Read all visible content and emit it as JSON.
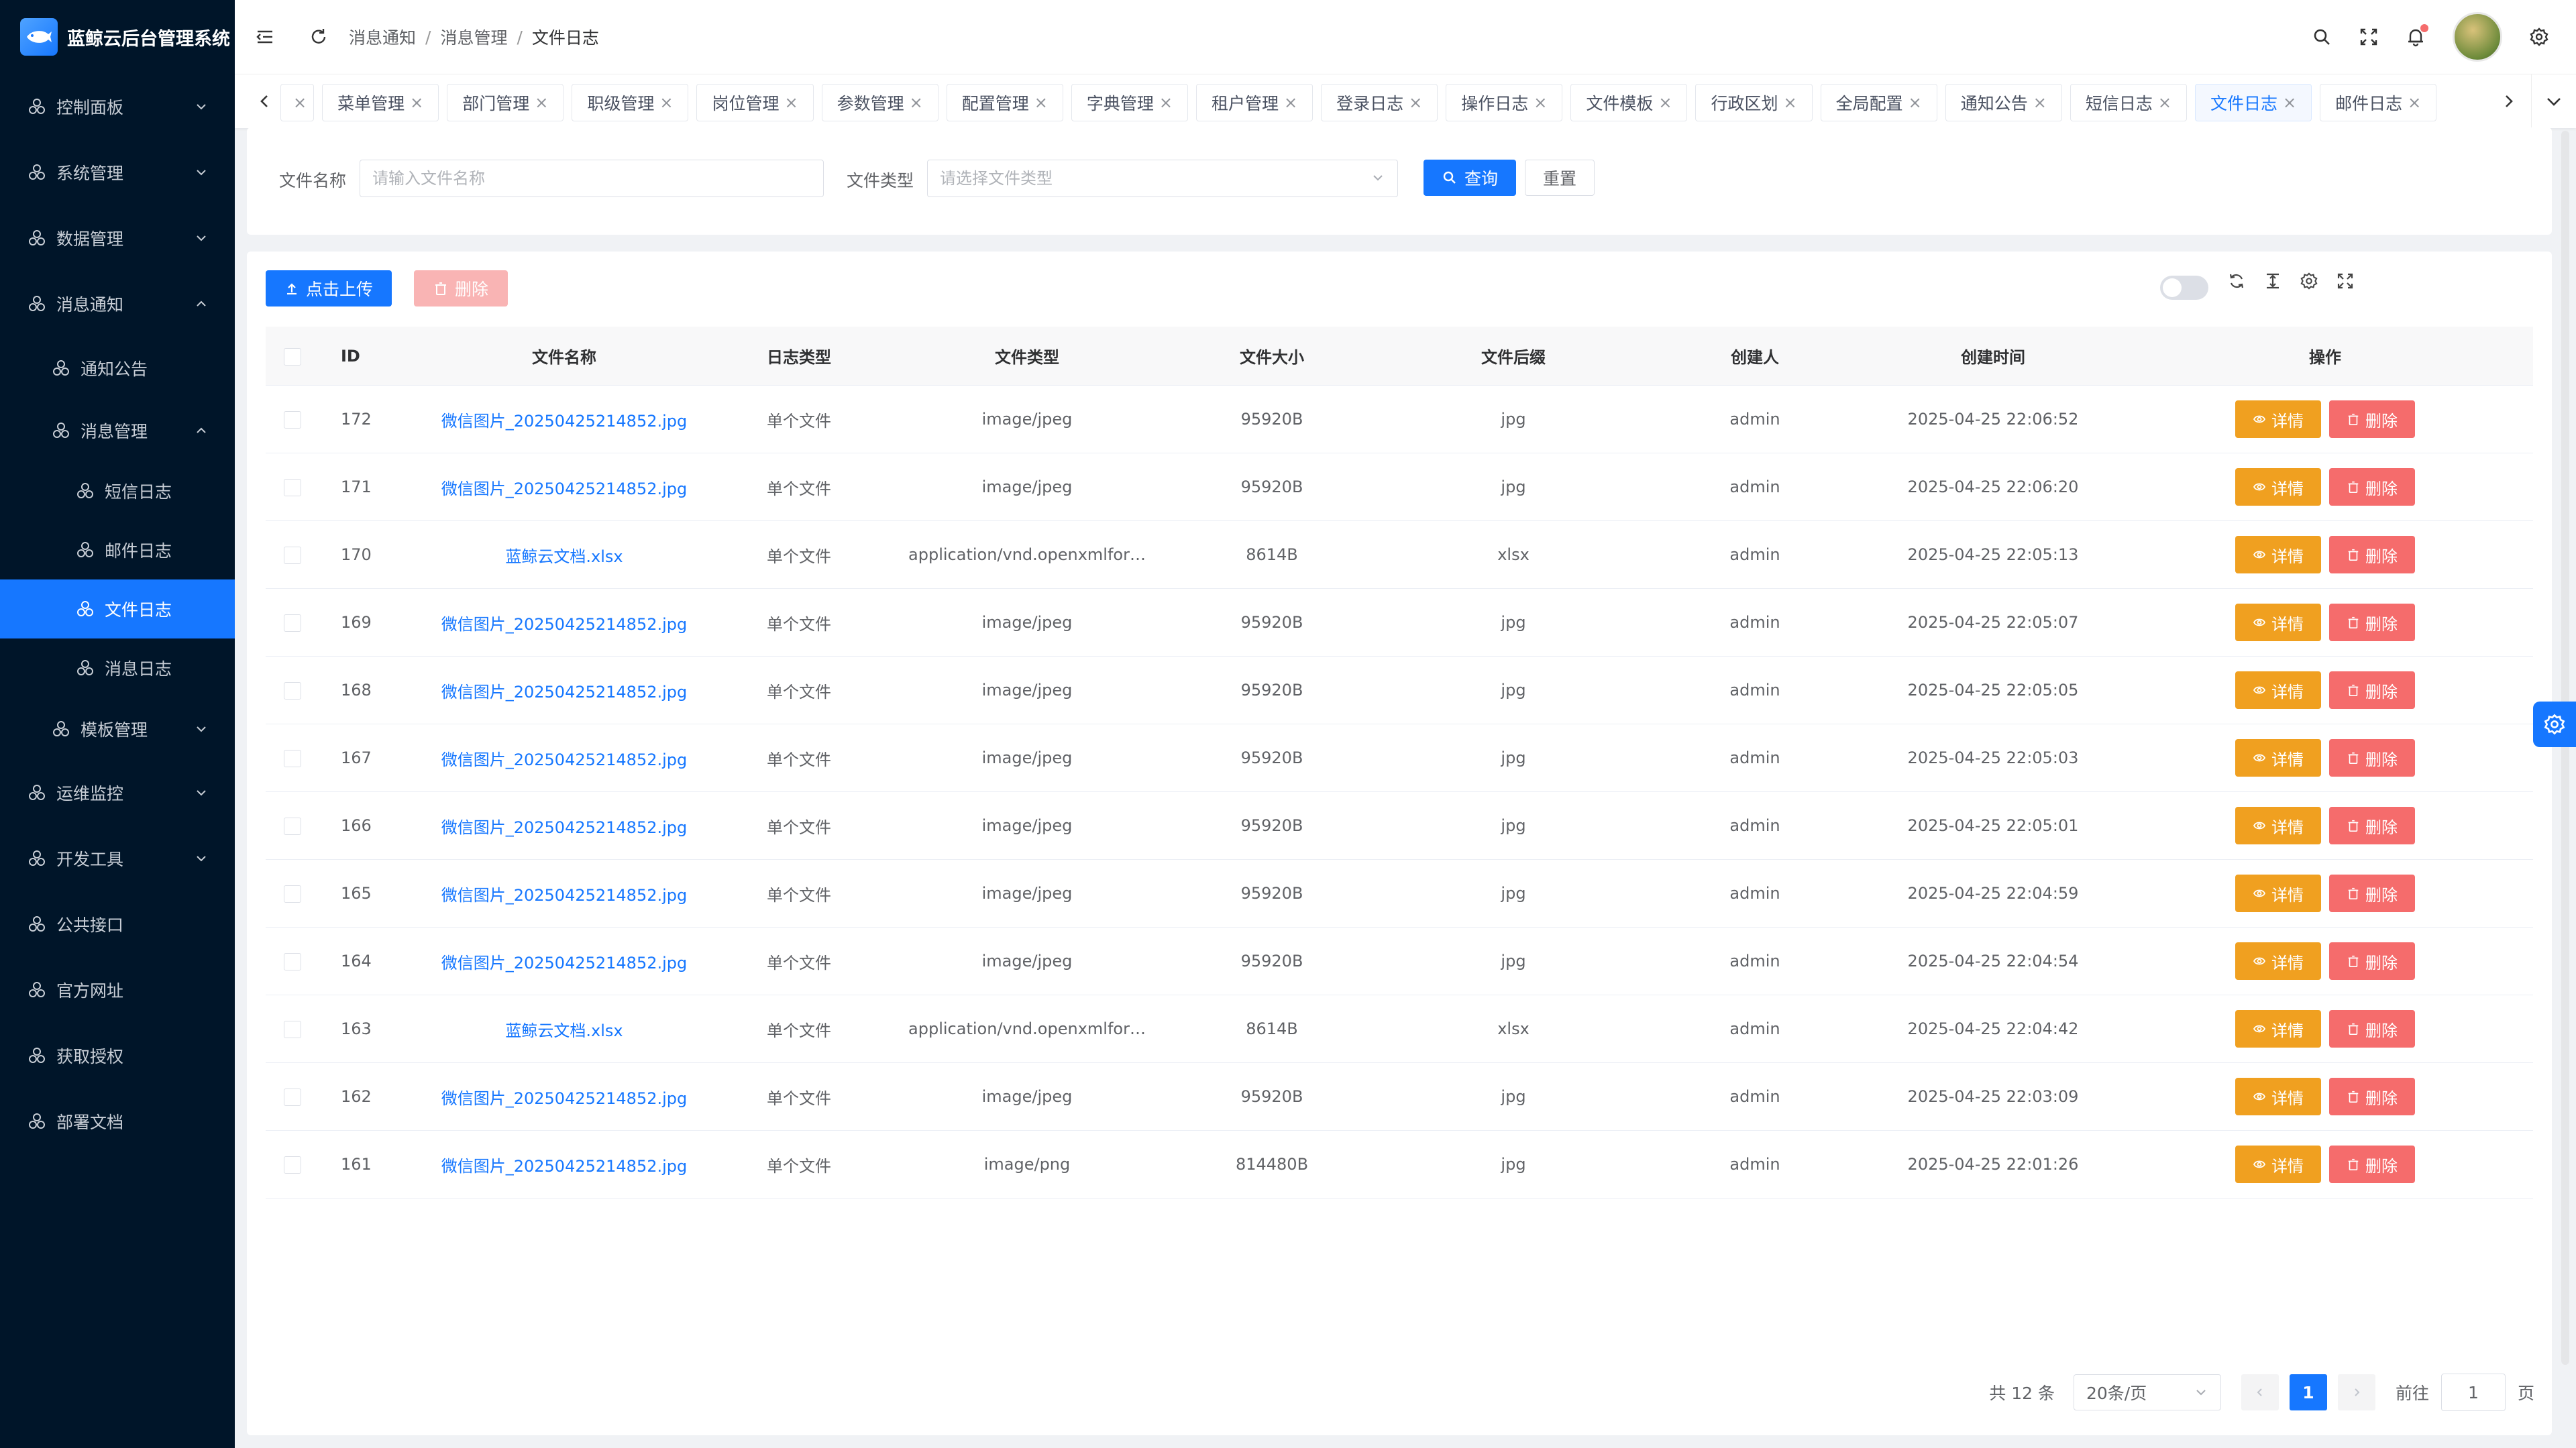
{
  "app": {
    "title": "蓝鲸云后台管理系统"
  },
  "sidebar": {
    "items": [
      {
        "label": "控制面板",
        "level": 1,
        "arrow": "down"
      },
      {
        "label": "系统管理",
        "level": 1,
        "arrow": "down"
      },
      {
        "label": "数据管理",
        "level": 1,
        "arrow": "down"
      },
      {
        "label": "消息通知",
        "level": 1,
        "arrow": "up"
      },
      {
        "label": "通知公告",
        "level": 2
      },
      {
        "label": "消息管理",
        "level": 2,
        "arrow": "up"
      },
      {
        "label": "短信日志",
        "level": 3
      },
      {
        "label": "邮件日志",
        "level": 3
      },
      {
        "label": "文件日志",
        "level": 3,
        "active": true
      },
      {
        "label": "消息日志",
        "level": 3
      },
      {
        "label": "模板管理",
        "level": 2,
        "arrow": "down"
      },
      {
        "label": "运维监控",
        "level": 1,
        "arrow": "down"
      },
      {
        "label": "开发工具",
        "level": 1,
        "arrow": "down"
      },
      {
        "label": "公共接口",
        "level": 1
      },
      {
        "label": "官方网址",
        "level": 1
      },
      {
        "label": "获取授权",
        "level": 1
      },
      {
        "label": "部署文档",
        "level": 1
      }
    ]
  },
  "breadcrumb": [
    "消息通知",
    "消息管理",
    "文件日志"
  ],
  "tabs": [
    "菜单管理",
    "部门管理",
    "职级管理",
    "岗位管理",
    "参数管理",
    "配置管理",
    "字典管理",
    "租户管理",
    "登录日志",
    "操作日志",
    "文件模板",
    "行政区划",
    "全局配置",
    "通知公告",
    "短信日志",
    "文件日志",
    "邮件日志"
  ],
  "active_tab": "文件日志",
  "search": {
    "file_name_label": "文件名称",
    "file_name_placeholder": "请输入文件名称",
    "file_type_label": "文件类型",
    "file_type_placeholder": "请选择文件类型",
    "query_button": "查询",
    "reset_button": "重置"
  },
  "toolbar": {
    "upload_button": "点击上传",
    "delete_button": "删除"
  },
  "table": {
    "columns": [
      "ID",
      "文件名称",
      "日志类型",
      "文件类型",
      "文件大小",
      "文件后缀",
      "创建人",
      "创建时间",
      "操作"
    ],
    "detail_label": "详情",
    "delete_label": "删除",
    "rows": [
      {
        "id": "172",
        "name": "微信图片_20250425214852.jpg",
        "log_type": "单个文件",
        "file_type": "image/jpeg",
        "size": "95920B",
        "suffix": "jpg",
        "creator": "admin",
        "created": "2025-04-25 22:06:52"
      },
      {
        "id": "171",
        "name": "微信图片_20250425214852.jpg",
        "log_type": "单个文件",
        "file_type": "image/jpeg",
        "size": "95920B",
        "suffix": "jpg",
        "creator": "admin",
        "created": "2025-04-25 22:06:20"
      },
      {
        "id": "170",
        "name": "蓝鲸云文档.xlsx",
        "log_type": "单个文件",
        "file_type": "application/vnd.openxmlfor…",
        "size": "8614B",
        "suffix": "xlsx",
        "creator": "admin",
        "created": "2025-04-25 22:05:13"
      },
      {
        "id": "169",
        "name": "微信图片_20250425214852.jpg",
        "log_type": "单个文件",
        "file_type": "image/jpeg",
        "size": "95920B",
        "suffix": "jpg",
        "creator": "admin",
        "created": "2025-04-25 22:05:07"
      },
      {
        "id": "168",
        "name": "微信图片_20250425214852.jpg",
        "log_type": "单个文件",
        "file_type": "image/jpeg",
        "size": "95920B",
        "suffix": "jpg",
        "creator": "admin",
        "created": "2025-04-25 22:05:05"
      },
      {
        "id": "167",
        "name": "微信图片_20250425214852.jpg",
        "log_type": "单个文件",
        "file_type": "image/jpeg",
        "size": "95920B",
        "suffix": "jpg",
        "creator": "admin",
        "created": "2025-04-25 22:05:03"
      },
      {
        "id": "166",
        "name": "微信图片_20250425214852.jpg",
        "log_type": "单个文件",
        "file_type": "image/jpeg",
        "size": "95920B",
        "suffix": "jpg",
        "creator": "admin",
        "created": "2025-04-25 22:05:01"
      },
      {
        "id": "165",
        "name": "微信图片_20250425214852.jpg",
        "log_type": "单个文件",
        "file_type": "image/jpeg",
        "size": "95920B",
        "suffix": "jpg",
        "creator": "admin",
        "created": "2025-04-25 22:04:59"
      },
      {
        "id": "164",
        "name": "微信图片_20250425214852.jpg",
        "log_type": "单个文件",
        "file_type": "image/jpeg",
        "size": "95920B",
        "suffix": "jpg",
        "creator": "admin",
        "created": "2025-04-25 22:04:54"
      },
      {
        "id": "163",
        "name": "蓝鲸云文档.xlsx",
        "log_type": "单个文件",
        "file_type": "application/vnd.openxmlfor…",
        "size": "8614B",
        "suffix": "xlsx",
        "creator": "admin",
        "created": "2025-04-25 22:04:42"
      },
      {
        "id": "162",
        "name": "微信图片_20250425214852.jpg",
        "log_type": "单个文件",
        "file_type": "image/jpeg",
        "size": "95920B",
        "suffix": "jpg",
        "creator": "admin",
        "created": "2025-04-25 22:03:09"
      },
      {
        "id": "161",
        "name": "微信图片_20250425214852.jpg",
        "log_type": "单个文件",
        "file_type": "image/png",
        "size": "814480B",
        "suffix": "jpg",
        "creator": "admin",
        "created": "2025-04-25 22:01:26"
      }
    ]
  },
  "pagination": {
    "total": "共 12 条",
    "page_size": "20条/页",
    "current_page": "1",
    "goto_label": "前往",
    "goto_value": "1",
    "page_suffix": "页"
  },
  "colors": {
    "primary": "#1677ff",
    "sidebar_bg": "#001529",
    "warning": "#f0a020",
    "danger": "#f56c6c"
  }
}
